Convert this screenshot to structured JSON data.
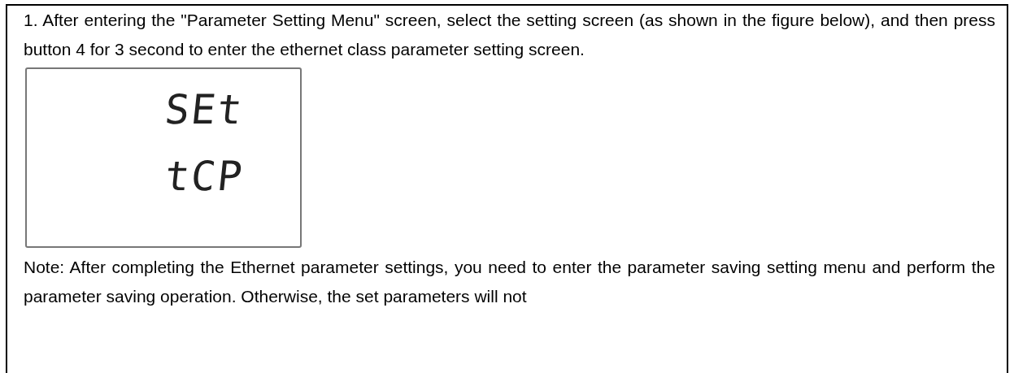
{
  "step": {
    "text": "1. After entering the \"Parameter Setting Menu\" screen, select the setting screen (as shown in the figure below), and then press button 4 for 3 second to enter the ethernet class parameter setting screen."
  },
  "figure": {
    "display_lines": [
      "SEt",
      "tCP"
    ]
  },
  "note": {
    "text": "Note: After completing the Ethernet parameter settings, you need to enter the parameter saving setting menu and perform the parameter saving operation. Otherwise, the set parameters will not"
  }
}
